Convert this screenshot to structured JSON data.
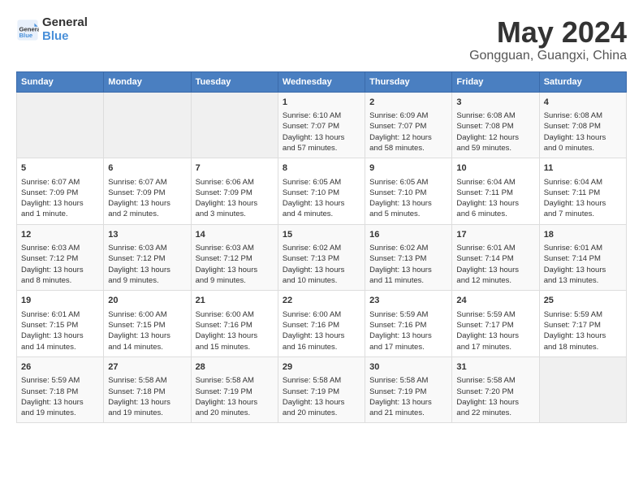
{
  "header": {
    "logo_line1": "General",
    "logo_line2": "Blue",
    "title": "May 2024",
    "subtitle": "Gongguan, Guangxi, China"
  },
  "days_of_week": [
    "Sunday",
    "Monday",
    "Tuesday",
    "Wednesday",
    "Thursday",
    "Friday",
    "Saturday"
  ],
  "weeks": [
    [
      {
        "num": "",
        "info": ""
      },
      {
        "num": "",
        "info": ""
      },
      {
        "num": "",
        "info": ""
      },
      {
        "num": "1",
        "info": "Sunrise: 6:10 AM\nSunset: 7:07 PM\nDaylight: 13 hours\nand 57 minutes."
      },
      {
        "num": "2",
        "info": "Sunrise: 6:09 AM\nSunset: 7:07 PM\nDaylight: 12 hours\nand 58 minutes."
      },
      {
        "num": "3",
        "info": "Sunrise: 6:08 AM\nSunset: 7:08 PM\nDaylight: 12 hours\nand 59 minutes."
      },
      {
        "num": "4",
        "info": "Sunrise: 6:08 AM\nSunset: 7:08 PM\nDaylight: 13 hours\nand 0 minutes."
      }
    ],
    [
      {
        "num": "5",
        "info": "Sunrise: 6:07 AM\nSunset: 7:09 PM\nDaylight: 13 hours\nand 1 minute."
      },
      {
        "num": "6",
        "info": "Sunrise: 6:07 AM\nSunset: 7:09 PM\nDaylight: 13 hours\nand 2 minutes."
      },
      {
        "num": "7",
        "info": "Sunrise: 6:06 AM\nSunset: 7:09 PM\nDaylight: 13 hours\nand 3 minutes."
      },
      {
        "num": "8",
        "info": "Sunrise: 6:05 AM\nSunset: 7:10 PM\nDaylight: 13 hours\nand 4 minutes."
      },
      {
        "num": "9",
        "info": "Sunrise: 6:05 AM\nSunset: 7:10 PM\nDaylight: 13 hours\nand 5 minutes."
      },
      {
        "num": "10",
        "info": "Sunrise: 6:04 AM\nSunset: 7:11 PM\nDaylight: 13 hours\nand 6 minutes."
      },
      {
        "num": "11",
        "info": "Sunrise: 6:04 AM\nSunset: 7:11 PM\nDaylight: 13 hours\nand 7 minutes."
      }
    ],
    [
      {
        "num": "12",
        "info": "Sunrise: 6:03 AM\nSunset: 7:12 PM\nDaylight: 13 hours\nand 8 minutes."
      },
      {
        "num": "13",
        "info": "Sunrise: 6:03 AM\nSunset: 7:12 PM\nDaylight: 13 hours\nand 9 minutes."
      },
      {
        "num": "14",
        "info": "Sunrise: 6:03 AM\nSunset: 7:12 PM\nDaylight: 13 hours\nand 9 minutes."
      },
      {
        "num": "15",
        "info": "Sunrise: 6:02 AM\nSunset: 7:13 PM\nDaylight: 13 hours\nand 10 minutes."
      },
      {
        "num": "16",
        "info": "Sunrise: 6:02 AM\nSunset: 7:13 PM\nDaylight: 13 hours\nand 11 minutes."
      },
      {
        "num": "17",
        "info": "Sunrise: 6:01 AM\nSunset: 7:14 PM\nDaylight: 13 hours\nand 12 minutes."
      },
      {
        "num": "18",
        "info": "Sunrise: 6:01 AM\nSunset: 7:14 PM\nDaylight: 13 hours\nand 13 minutes."
      }
    ],
    [
      {
        "num": "19",
        "info": "Sunrise: 6:01 AM\nSunset: 7:15 PM\nDaylight: 13 hours\nand 14 minutes."
      },
      {
        "num": "20",
        "info": "Sunrise: 6:00 AM\nSunset: 7:15 PM\nDaylight: 13 hours\nand 14 minutes."
      },
      {
        "num": "21",
        "info": "Sunrise: 6:00 AM\nSunset: 7:16 PM\nDaylight: 13 hours\nand 15 minutes."
      },
      {
        "num": "22",
        "info": "Sunrise: 6:00 AM\nSunset: 7:16 PM\nDaylight: 13 hours\nand 16 minutes."
      },
      {
        "num": "23",
        "info": "Sunrise: 5:59 AM\nSunset: 7:16 PM\nDaylight: 13 hours\nand 17 minutes."
      },
      {
        "num": "24",
        "info": "Sunrise: 5:59 AM\nSunset: 7:17 PM\nDaylight: 13 hours\nand 17 minutes."
      },
      {
        "num": "25",
        "info": "Sunrise: 5:59 AM\nSunset: 7:17 PM\nDaylight: 13 hours\nand 18 minutes."
      }
    ],
    [
      {
        "num": "26",
        "info": "Sunrise: 5:59 AM\nSunset: 7:18 PM\nDaylight: 13 hours\nand 19 minutes."
      },
      {
        "num": "27",
        "info": "Sunrise: 5:58 AM\nSunset: 7:18 PM\nDaylight: 13 hours\nand 19 minutes."
      },
      {
        "num": "28",
        "info": "Sunrise: 5:58 AM\nSunset: 7:19 PM\nDaylight: 13 hours\nand 20 minutes."
      },
      {
        "num": "29",
        "info": "Sunrise: 5:58 AM\nSunset: 7:19 PM\nDaylight: 13 hours\nand 20 minutes."
      },
      {
        "num": "30",
        "info": "Sunrise: 5:58 AM\nSunset: 7:19 PM\nDaylight: 13 hours\nand 21 minutes."
      },
      {
        "num": "31",
        "info": "Sunrise: 5:58 AM\nSunset: 7:20 PM\nDaylight: 13 hours\nand 22 minutes."
      },
      {
        "num": "",
        "info": ""
      }
    ]
  ]
}
